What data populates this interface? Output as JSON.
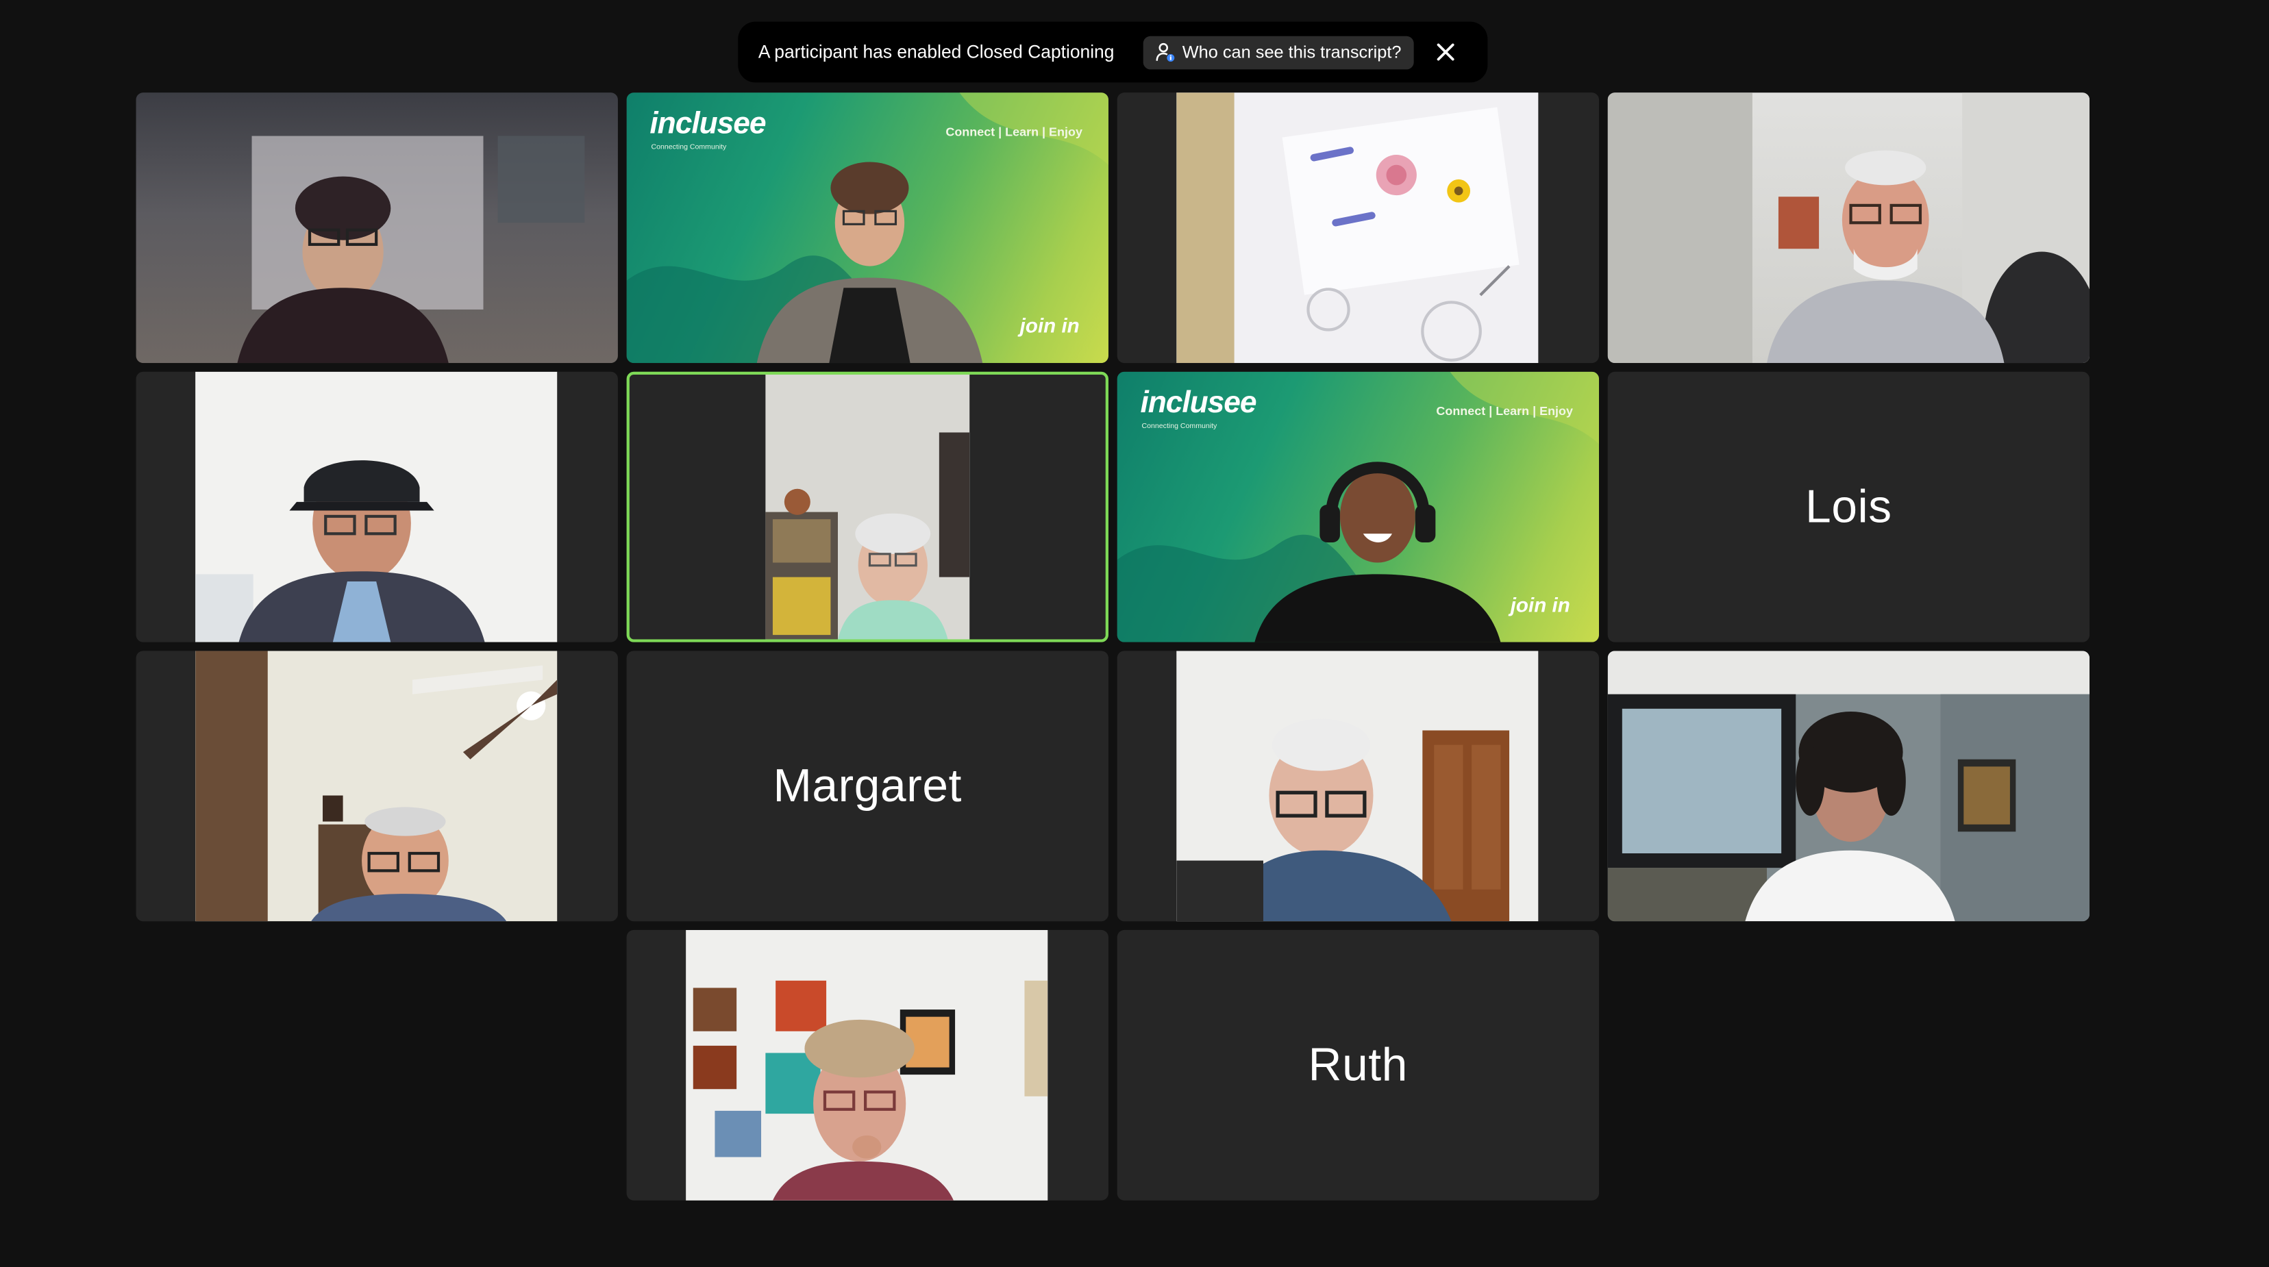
{
  "banner": {
    "text": "A participant has enabled Closed Captioning",
    "who_button": "Who can see this transcript?",
    "who_icon": "person-info-icon",
    "close_icon": "close-icon"
  },
  "brand": {
    "logo": "inclusee",
    "sub": "Connecting Community",
    "tagline": "Connect | Learn | Enjoy",
    "cta": "join in",
    "shirt_text": "join in"
  },
  "participants": {
    "lois": "Lois",
    "margaret": "Margaret",
    "ruth": "Ruth"
  },
  "colors": {
    "app_bg": "#111111",
    "tile_bg": "#262626",
    "active_speaker_border": "#7ed957"
  }
}
